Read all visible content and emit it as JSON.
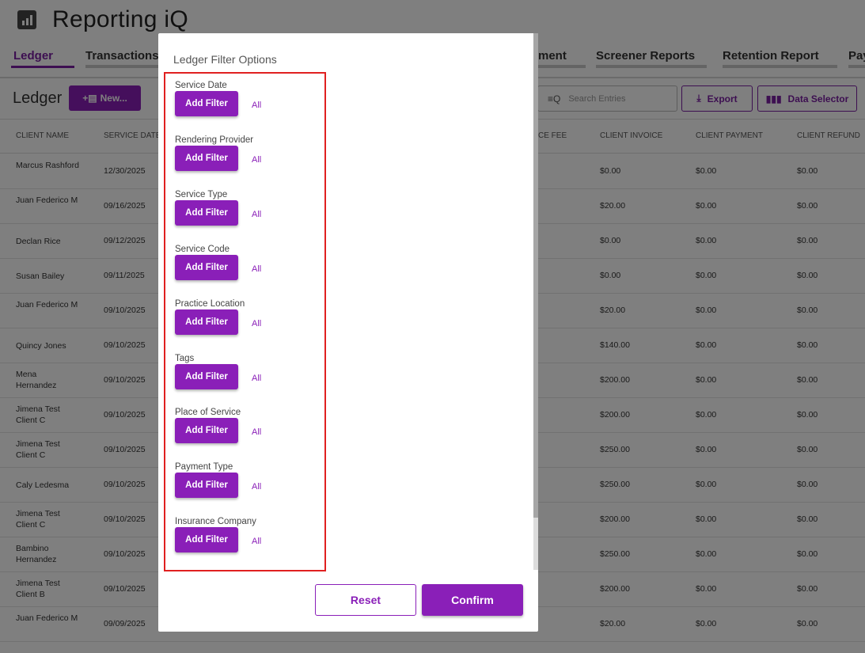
{
  "app": {
    "title": "Reporting iQ"
  },
  "tabs": [
    {
      "label": "Ledger",
      "active": true
    },
    {
      "label": "Transactions F"
    },
    {
      "label": "ment"
    },
    {
      "label": "Screener Reports"
    },
    {
      "label": "Retention Report"
    },
    {
      "label": "Pay"
    }
  ],
  "toolbar": {
    "page_title": "Ledger",
    "new_label": "New...",
    "search_placeholder": "Search Entries",
    "export_label": "Export",
    "data_selector_label": "Data Selector"
  },
  "table": {
    "headers": [
      "CLIENT NAME",
      "SERVICE DATE",
      "CE FEE",
      "CLIENT INVOICE",
      "CLIENT PAYMENT",
      "CLIENT REFUND"
    ],
    "rows": [
      {
        "name": "Marcus Rashford",
        "date": "12/30/2025",
        "invoice": "$0.00",
        "payment": "$0.00",
        "refund": "$0.00"
      },
      {
        "name": "Juan Federico M",
        "date": "09/16/2025",
        "invoice": "$20.00",
        "payment": "$0.00",
        "refund": "$0.00"
      },
      {
        "name": "Declan Rice",
        "date": "09/12/2025",
        "invoice": "$0.00",
        "payment": "$0.00",
        "refund": "$0.00"
      },
      {
        "name": "Susan Bailey",
        "date": "09/11/2025",
        "invoice": "$0.00",
        "payment": "$0.00",
        "refund": "$0.00"
      },
      {
        "name": "Juan Federico M",
        "date": "09/10/2025",
        "invoice": "$20.00",
        "payment": "$0.00",
        "refund": "$0.00"
      },
      {
        "name": "Quincy Jones",
        "date": "09/10/2025",
        "invoice": "$140.00",
        "payment": "$0.00",
        "refund": "$0.00"
      },
      {
        "name": "Mena Hernandez",
        "date": "09/10/2025",
        "invoice": "$200.00",
        "payment": "$0.00",
        "refund": "$0.00"
      },
      {
        "name": "Jimena Test Client C",
        "date": "09/10/2025",
        "invoice": "$200.00",
        "payment": "$0.00",
        "refund": "$0.00"
      },
      {
        "name": "Jimena Test Client C",
        "date": "09/10/2025",
        "invoice": "$250.00",
        "payment": "$0.00",
        "refund": "$0.00"
      },
      {
        "name": "Caly Ledesma",
        "date": "09/10/2025",
        "invoice": "$250.00",
        "payment": "$0.00",
        "refund": "$0.00"
      },
      {
        "name": "Jimena Test Client C",
        "date": "09/10/2025",
        "invoice": "$200.00",
        "payment": "$0.00",
        "refund": "$0.00"
      },
      {
        "name": "Bambino Hernandez",
        "date": "09/10/2025",
        "invoice": "$250.00",
        "payment": "$0.00",
        "refund": "$0.00"
      },
      {
        "name": "Jimena Test Client B",
        "date": "09/10/2025",
        "invoice": "$200.00",
        "payment": "$0.00",
        "refund": "$0.00"
      },
      {
        "name": "Juan Federico M",
        "date": "09/09/2025",
        "invoice": "$20.00",
        "payment": "$0.00",
        "refund": "$0.00"
      }
    ]
  },
  "modal": {
    "title": "Ledger Filter Options",
    "add_filter_label": "Add Filter",
    "all_label": "All",
    "filters": [
      {
        "label": "Service Date"
      },
      {
        "label": "Rendering Provider"
      },
      {
        "label": "Service Type"
      },
      {
        "label": "Service Code"
      },
      {
        "label": "Practice Location"
      },
      {
        "label": "Tags"
      },
      {
        "label": "Place of Service"
      },
      {
        "label": "Payment Type"
      },
      {
        "label": "Insurance Company"
      }
    ],
    "reset_label": "Reset",
    "confirm_label": "Confirm"
  },
  "colors": {
    "accent": "#8a1fb8",
    "highlight_border": "#e02020"
  }
}
